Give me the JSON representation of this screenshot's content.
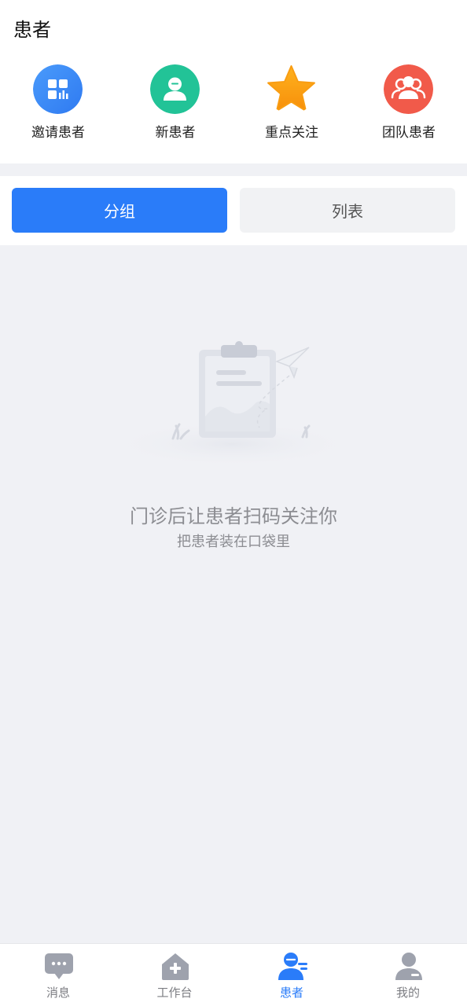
{
  "page": {
    "title": "患者"
  },
  "shortcuts": [
    {
      "label": "邀请患者",
      "icon": "qr-code-icon",
      "color": "#3d8bf7"
    },
    {
      "label": "新患者",
      "icon": "new-patient-icon",
      "color": "#22c397"
    },
    {
      "label": "重点关注",
      "icon": "star-icon",
      "color": "#f99d12"
    },
    {
      "label": "团队患者",
      "icon": "team-icon",
      "color": "#f15a4a"
    }
  ],
  "tabs": {
    "group_label": "分组",
    "list_label": "列表",
    "active": "group"
  },
  "empty_state": {
    "title": "门诊后让患者扫码关注你",
    "subtitle": "把患者装在口袋里",
    "illustration": "clipboard-paper-plane-illustration"
  },
  "bottom_nav": [
    {
      "label": "消息",
      "icon": "message-icon"
    },
    {
      "label": "工作台",
      "icon": "workbench-icon"
    },
    {
      "label": "患者",
      "icon": "patient-icon",
      "active": true
    },
    {
      "label": "我的",
      "icon": "profile-icon"
    }
  ],
  "colors": {
    "accent": "#2a7cf9",
    "background": "#f0f1f5",
    "inactive_icon": "#9ea2ad"
  }
}
